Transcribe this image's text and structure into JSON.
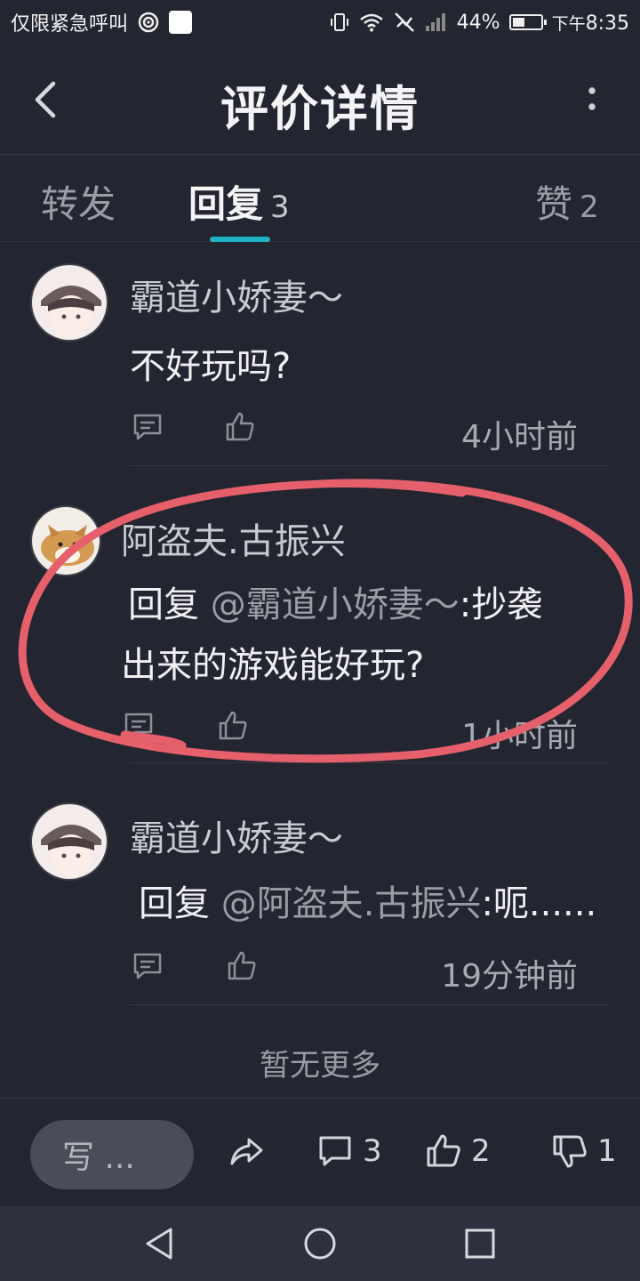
{
  "status_bar": {
    "carrier_text": "仅限紧急呼叫",
    "battery_percent": "44%",
    "battery_level": 0.44,
    "time": "下午8:35",
    "time_prefix": "下午",
    "time_value": "8:35",
    "icons": [
      "hotspot-icon",
      "notification-square-icon",
      "vibrate-icon",
      "wifi-icon",
      "no-sim-icon",
      "signal-icon",
      "battery-icon"
    ]
  },
  "header": {
    "title": "评价详情"
  },
  "tabs": [
    {
      "label": "转发",
      "count": ""
    },
    {
      "label": "回复",
      "count": "3"
    },
    {
      "label": "赞",
      "count": "2"
    }
  ],
  "comments": [
    {
      "username": "霸道小娇妻～",
      "text": "不好玩吗?",
      "time": "4小时前",
      "avatar": "girl-with-cap-avatar"
    },
    {
      "username": "阿盗夫.古振兴",
      "reply_prefix": "回复",
      "mention": "@霸道小娇妻～",
      "text_line1": ":抄袭",
      "text_line2": "出来的游戏能好玩?",
      "time": "1小时前",
      "avatar": "shiba-dog-avatar"
    },
    {
      "username": "霸道小娇妻～",
      "reply_prefix": "回复",
      "mention": "@阿盗夫.古振兴",
      "text": ":呃......",
      "time": "19分钟前",
      "avatar": "girl-with-cap-avatar"
    }
  ],
  "no_more_text": "暂无更多",
  "bottom_bar": {
    "write_placeholder": "写 ...",
    "comment_count": "3",
    "like_count": "2",
    "dislike_count": "1"
  },
  "annotation_color": "#e5606b",
  "accent_color": "#1fb3c4"
}
